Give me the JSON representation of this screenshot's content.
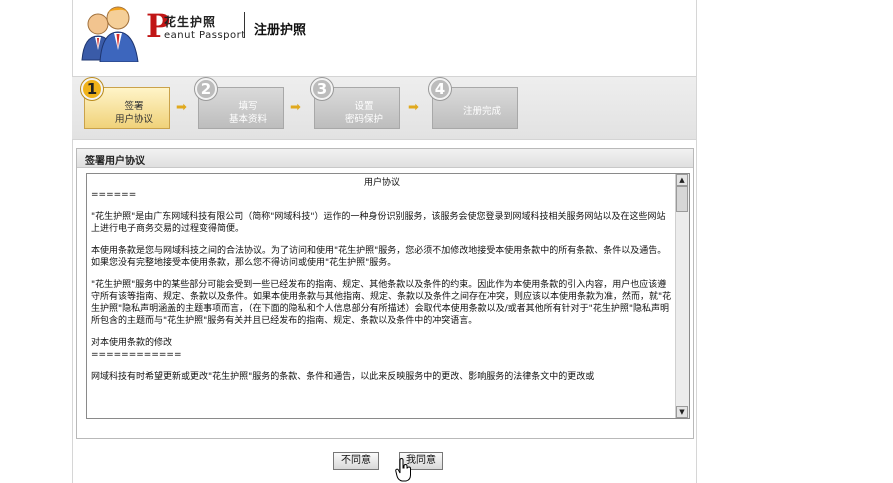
{
  "header": {
    "brand_initial": "P",
    "brand_cn": "花生护照",
    "brand_en": "eanut Passport",
    "page_title": "注册护照"
  },
  "steps": [
    {
      "num": "1",
      "line1": "签署",
      "line2": "用户协议",
      "active": true
    },
    {
      "num": "2",
      "line1": "填写",
      "line2": "基本资料",
      "active": false
    },
    {
      "num": "3",
      "line1": "设置",
      "line2": "密码保护",
      "active": false
    },
    {
      "num": "4",
      "line1": "注册完成",
      "line2": "",
      "active": false
    }
  ],
  "panel": {
    "title": "签署用户协议",
    "agreement": {
      "heading": "用户协议",
      "sep1": "======",
      "p1": "\"花生护照\"是由广东网域科技有限公司（简称\"网域科技\"）运作的一种身份识别服务，该服务会使您登录到网域科技相关服务网站以及在这些网站上进行电子商务交易的过程变得简便。",
      "p2": "本使用条款是您与网域科技之间的合法协议。为了访问和使用\"花生护照\"服务，您必须不加修改地接受本使用条款中的所有条款、条件以及通告。如果您没有完整地接受本使用条款，那么您不得访问或使用\"花生护照\"服务。",
      "p3": "\"花生护照\"服务中的某些部分可能会受到一些已经发布的指南、规定、其他条款以及条件的约束。因此作为本使用条款的引入内容，用户也应该遵守所有该等指南、规定、条款以及条件。如果本使用条款与其他指南、规定、条款以及条件之间存在冲突，则应该以本使用条款为准，然而，就\"花生护照\"隐私声明涵盖的主题事项而言，（在下面的隐私和个人信息部分有所描述）会取代本使用条款以及/或者其他所有针对于\"花生护照\"隐私声明所包含的主题而与\"花生护照\"服务有关并且已经发布的指南、规定、条款以及条件中的冲突语言。",
      "section": "对本使用条款的修改",
      "sep2": "============",
      "p4": "网域科技有时希望更新或更改\"花生护照\"服务的条款、条件和通告，以此来反映服务中的更改、影响服务的法律条文中的更改或"
    },
    "scroll_up": "▲",
    "scroll_down": "▼"
  },
  "buttons": {
    "disagree": "不同意",
    "agree": "我同意"
  },
  "colors": {
    "active_step": "#f0d27a",
    "inactive_step": "#bdbdbd",
    "arrow": "#e0a91e",
    "brand_red": "#c11616"
  }
}
